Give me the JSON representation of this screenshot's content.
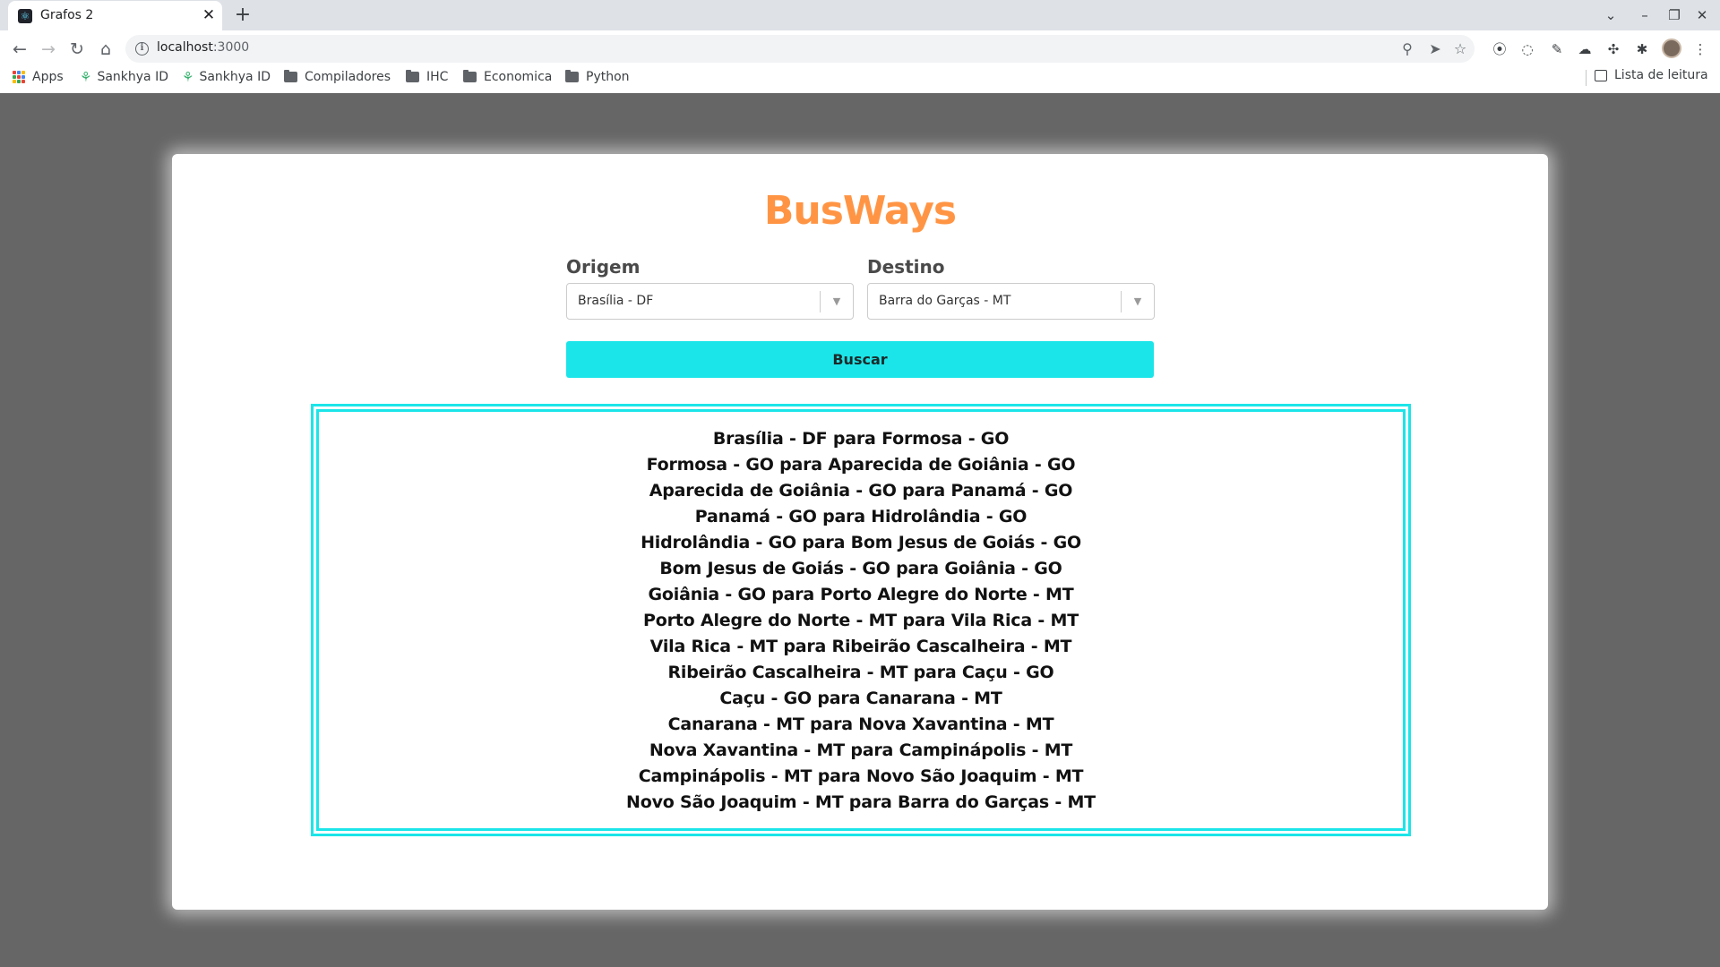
{
  "browser": {
    "tab": {
      "title": "Grafos 2",
      "favicon": "react-icon"
    },
    "address": {
      "host": "localhost",
      "port": ":3000"
    },
    "bookmarks": [
      {
        "label": "Apps",
        "icon": "apps-grid-icon"
      },
      {
        "label": "Sankhya ID",
        "icon": "sankhya-leaf-icon"
      },
      {
        "label": "Sankhya ID",
        "icon": "sankhya-leaf-icon"
      },
      {
        "label": "Compiladores",
        "icon": "folder-icon"
      },
      {
        "label": "IHC",
        "icon": "folder-icon"
      },
      {
        "label": "Economica",
        "icon": "folder-icon"
      },
      {
        "label": "Python",
        "icon": "folder-icon"
      }
    ],
    "reading_list": "Lista de leitura"
  },
  "app": {
    "logo": "BusWays",
    "colors": {
      "logo": "#ff9544",
      "accent": "#1ce5e9"
    },
    "origin": {
      "label": "Origem",
      "value": "Brasília - DF"
    },
    "destination": {
      "label": "Destino",
      "value": "Barra do Garças - MT"
    },
    "search_label": "Buscar",
    "routes": [
      "Brasília - DF para Formosa - GO",
      "Formosa - GO para Aparecida de Goiânia - GO",
      "Aparecida de Goiânia - GO para Panamá - GO",
      "Panamá - GO para Hidrolândia - GO",
      "Hidrolândia - GO para Bom Jesus de Goiás - GO",
      "Bom Jesus de Goiás - GO para Goiânia - GO",
      "Goiânia - GO para Porto Alegre do Norte - MT",
      "Porto Alegre do Norte - MT para Vila Rica - MT",
      "Vila Rica - MT para Ribeirão Cascalheira - MT",
      "Ribeirão Cascalheira - MT para Caçu - GO",
      "Caçu - GO para Canarana - MT",
      "Canarana - MT para Nova Xavantina - MT",
      "Nova Xavantina - MT para Campinápolis - MT",
      "Campinápolis - MT para Novo São Joaquim - MT",
      "Novo São Joaquim - MT para Barra do Garças - MT"
    ]
  }
}
